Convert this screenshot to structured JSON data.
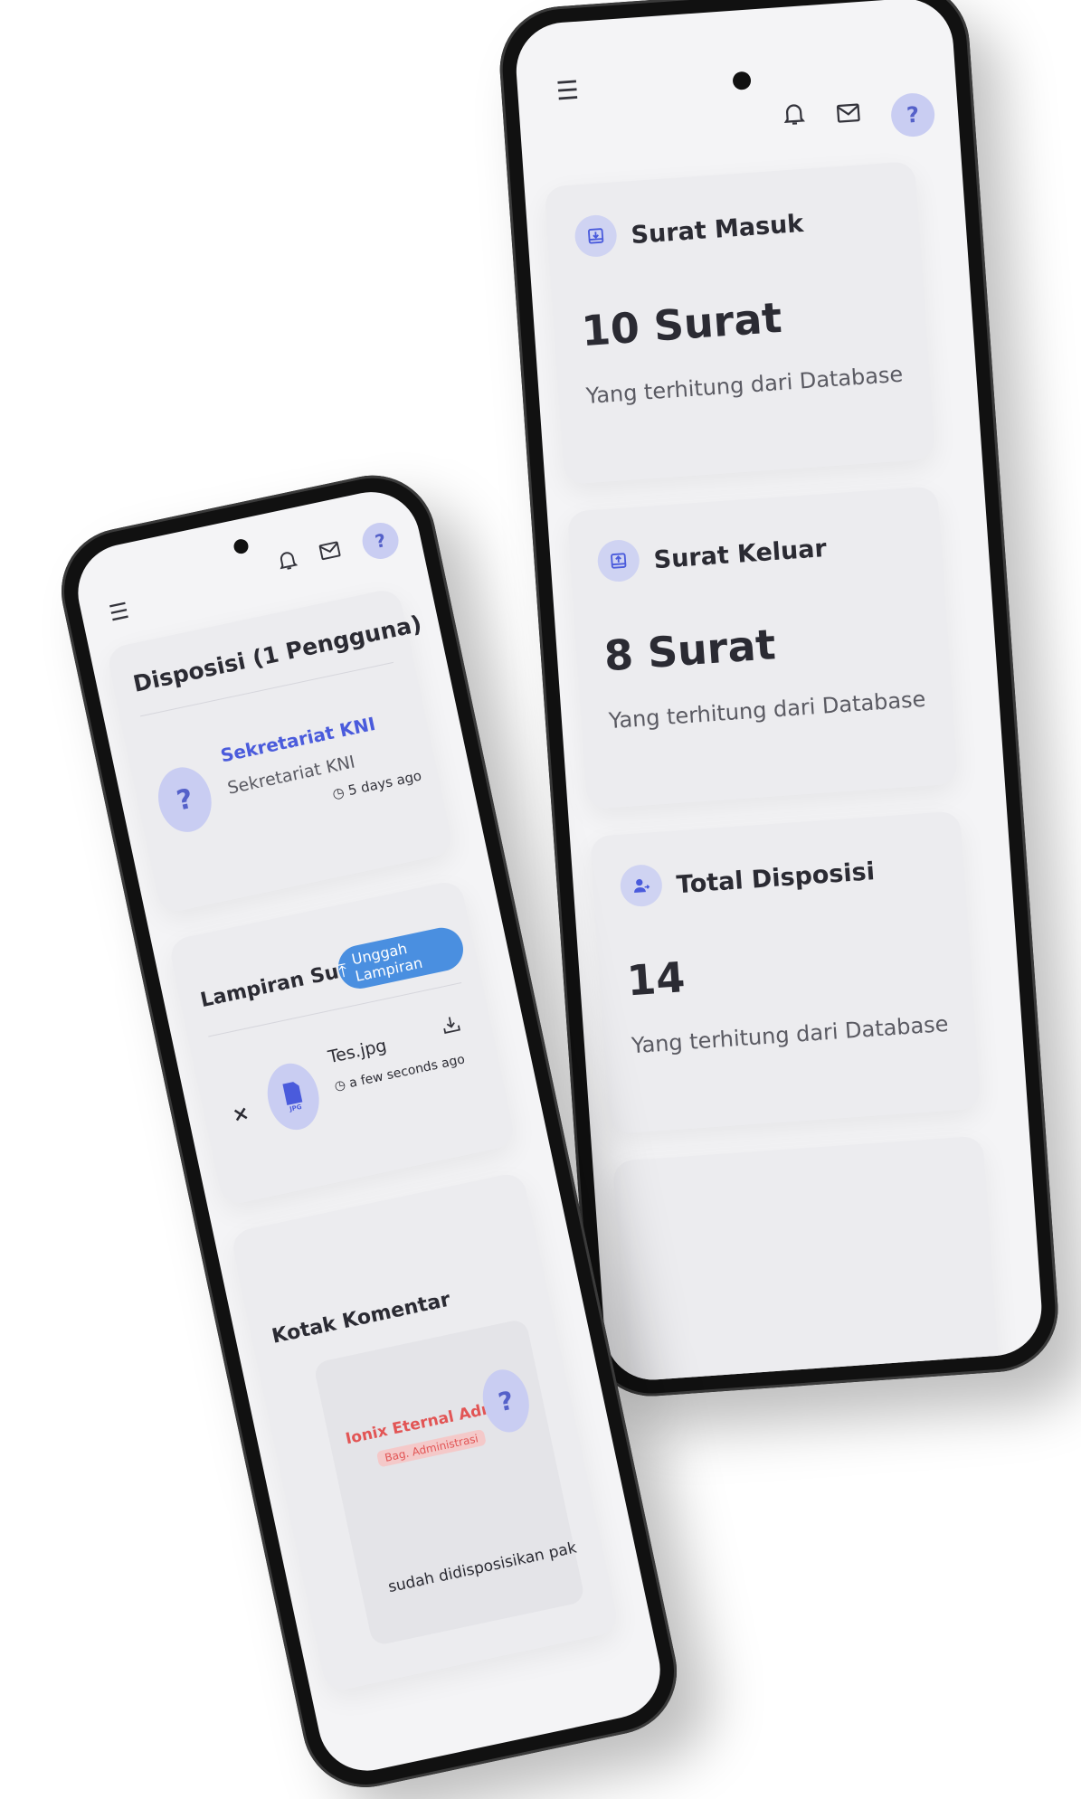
{
  "right_phone": {
    "header": {
      "menu_icon": "hamburger-icon",
      "notification_icon": "bell-icon",
      "mail_icon": "envelope-icon",
      "avatar_label": "?"
    },
    "stats": [
      {
        "icon": "inbox-download-icon",
        "title": "Surat Masuk",
        "value": "10 Surat",
        "desc": "Yang terhitung dari Database"
      },
      {
        "icon": "inbox-upload-icon",
        "title": "Surat Keluar",
        "value": "8 Surat",
        "desc": "Yang terhitung dari Database"
      },
      {
        "icon": "user-arrow-icon",
        "title": "Total Disposisi",
        "value": "14",
        "desc": "Yang terhitung dari Database"
      }
    ]
  },
  "left_phone": {
    "header": {
      "menu_icon": "hamburger-icon",
      "notification_icon": "bell-icon",
      "mail_icon": "envelope-icon",
      "avatar_label": "?"
    },
    "disposisi": {
      "title": "Disposisi (1 Pengguna)",
      "item": {
        "avatar_label": "?",
        "name": "Sekretariat KNI",
        "subtitle": "Sekretariat KNI",
        "time": "5 days ago"
      }
    },
    "lampiran": {
      "title": "Lampiran Surat",
      "upload_button": "Unggah Lampiran",
      "file": {
        "type_label": "JPG",
        "name": "Tes.jpg",
        "time": "a few seconds ago",
        "remove_label": "×"
      }
    },
    "komentar": {
      "title": "Kotak Komentar",
      "comment": {
        "author": "Ionix Eternal Admin",
        "role": "Bag. Administrasi",
        "avatar_label": "?",
        "text": "sudah didisposisikan pak"
      }
    },
    "colors": {
      "accent_blue": "#4a5bdc",
      "author_red": "#e25555",
      "upload_button": "#4a8fe0"
    }
  }
}
